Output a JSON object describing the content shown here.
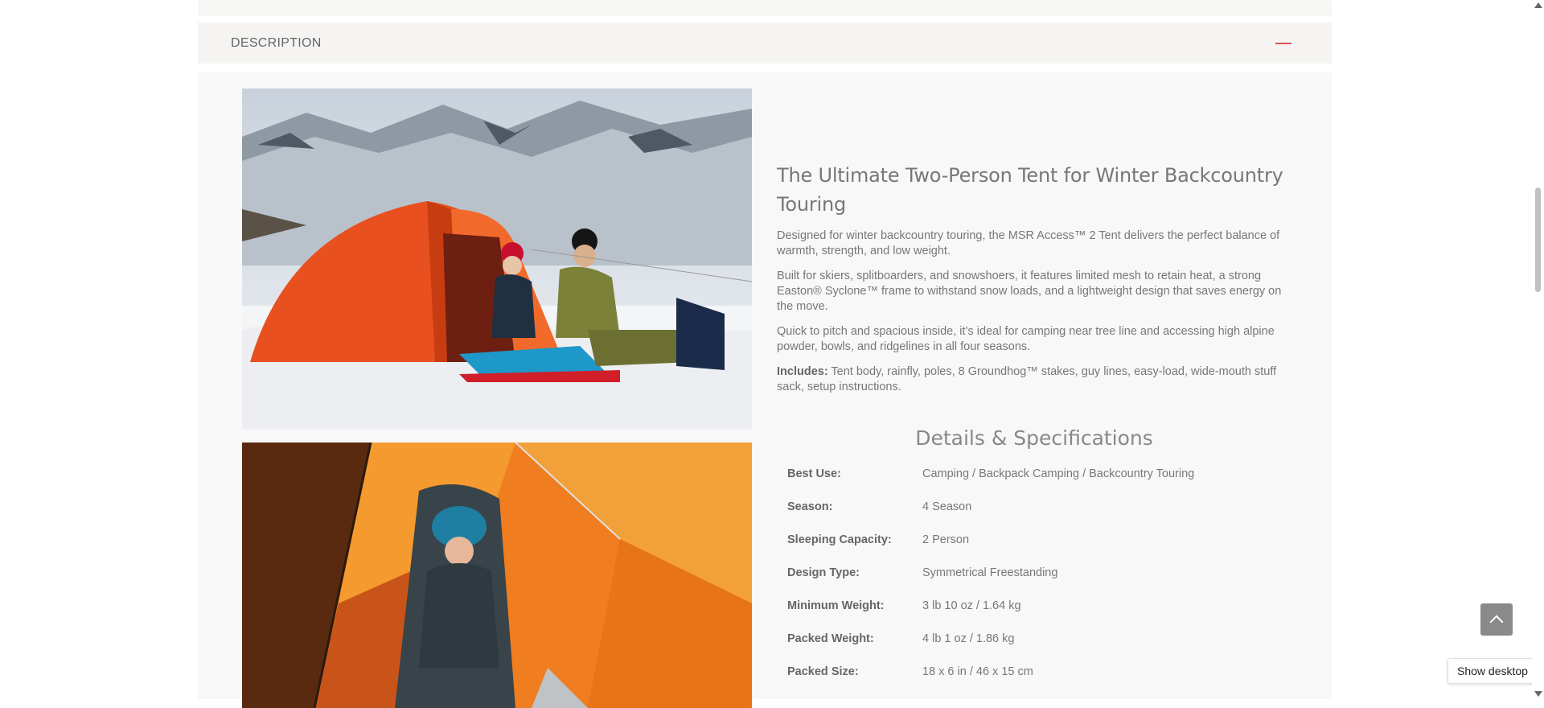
{
  "accordion": {
    "title": "DESCRIPTION",
    "toggle_icon": "minus-icon",
    "accent_color": "#d9534f"
  },
  "description": {
    "heading": "The Ultimate Two-Person Tent for Winter Backcountry Touring",
    "paragraphs": [
      "Designed for winter backcountry touring, the MSR Access™ 2 Tent delivers the perfect balance of warmth, strength, and low weight.",
      "Built for skiers, splitboarders, and snowshoers, it features limited mesh to retain heat, a strong Easton® Syclone™ frame to withstand snow loads, and a lightweight design that saves energy on the move.",
      "Quick to pitch and spacious inside, it’s ideal for camping near tree line and accessing high alpine powder, bowls, and ridgelines in all four seasons."
    ],
    "includes_label": "Includes:",
    "includes_text": " Tent body, rainfly, poles, 8 Groundhog™ stakes, guy lines, easy-load, wide-mouth stuff sack, setup instructions."
  },
  "specs": {
    "title": "Details & Specifications",
    "rows": [
      {
        "label": "Best Use:",
        "value": "Camping / Backpack Camping / Backcountry Touring"
      },
      {
        "label": "Season:",
        "value": "4 Season"
      },
      {
        "label": "Sleeping Capacity:",
        "value": "2 Person"
      },
      {
        "label": "Design Type:",
        "value": "Symmetrical Freestanding"
      },
      {
        "label": "Minimum Weight:",
        "value": "3 lb 10 oz / 1.64 kg"
      },
      {
        "label": "Packed Weight:",
        "value": "4 lb 1 oz / 1.86 kg"
      },
      {
        "label": "Packed Size:",
        "value": "18 x 6 in / 46 x 15 cm"
      }
    ]
  },
  "controls": {
    "back_to_top_icon": "chevron-up-icon",
    "tooltip": "Show desktop"
  }
}
